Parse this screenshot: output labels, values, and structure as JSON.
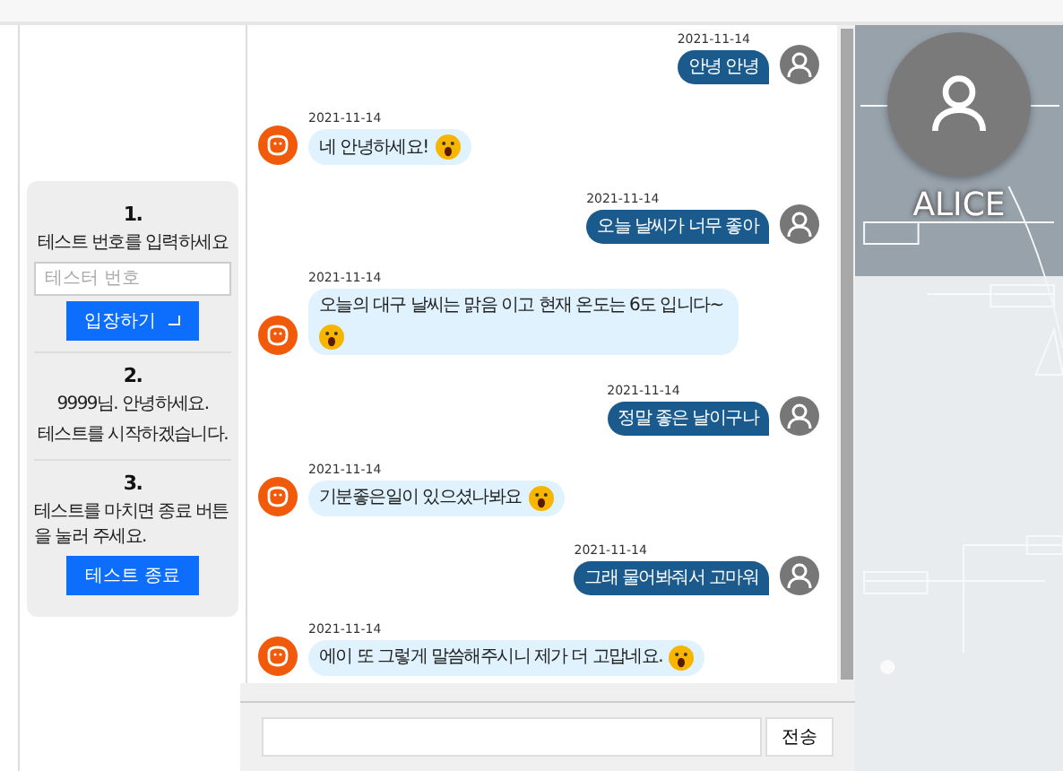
{
  "steps": [
    {
      "number": "1.",
      "text": "테스트 번호를 입력하세요",
      "field": {
        "placeholder": "테스터 번호"
      },
      "button": "입장하기"
    },
    {
      "number": "2.",
      "lines": [
        "9999님. 안녕하세요.",
        "테스트를 시작하겠습니다."
      ]
    },
    {
      "number": "3.",
      "text": "테스트를 마치면 종료 버튼을 눌러 주세요.",
      "button": "테스트 종료"
    }
  ],
  "messages": [
    {
      "kind": "me",
      "date": "2021-11-14",
      "text": "안녕 안녕"
    },
    {
      "kind": "bot",
      "date": "2021-11-14",
      "text": "네 안녕하세요!",
      "emoji": true
    },
    {
      "kind": "me",
      "date": "2021-11-14",
      "text": "오늘 날씨가 너무 좋아"
    },
    {
      "kind": "bot",
      "date": "2021-11-14",
      "text": "오늘의 대구 날씨는 맑음 이고 현재 온도는 6도 입니다~",
      "emoji": true
    },
    {
      "kind": "me",
      "date": "2021-11-14",
      "text": "정말 좋은 날이구나"
    },
    {
      "kind": "bot",
      "date": "2021-11-14",
      "text": "기분좋은일이 있으셨나봐요",
      "emoji": true
    },
    {
      "kind": "me",
      "date": "2021-11-14",
      "text": "그래 물어봐줘서 고마워"
    },
    {
      "kind": "bot",
      "date": "2021-11-14",
      "text": "에이 또 그렇게 말씀해주시니 제가 더 고맙네요.",
      "emoji": true
    }
  ],
  "composer": {
    "button": "전송"
  },
  "profile": {
    "name": "ALICE"
  }
}
